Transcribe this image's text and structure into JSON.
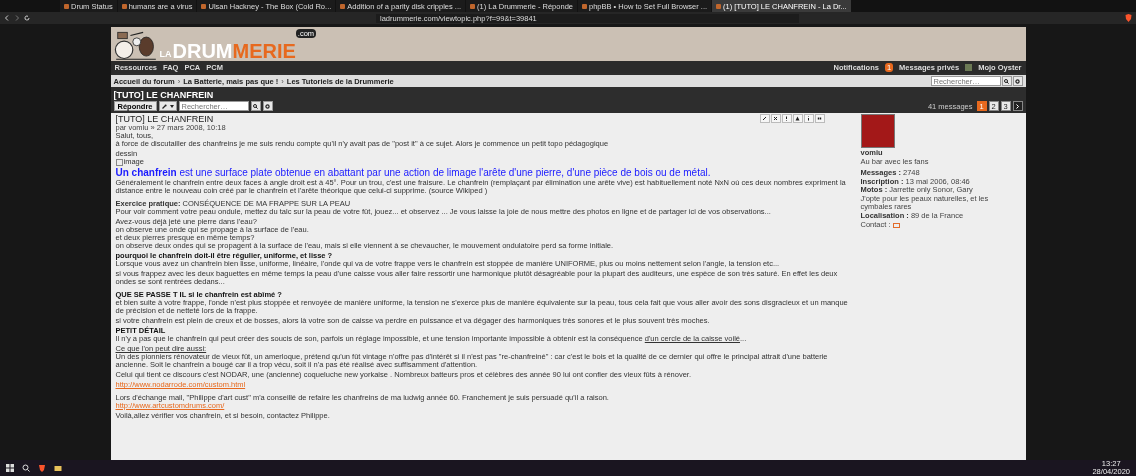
{
  "browser": {
    "tabs": [
      {
        "label": "Drum Status",
        "selected": false
      },
      {
        "label": "humans are a virus",
        "selected": false
      },
      {
        "label": "Ulsan Hackney - The Box (Cold Ro...",
        "selected": false
      },
      {
        "label": "Addition of a parity disk cripples ...",
        "selected": false
      },
      {
        "label": "(1) La Drummerie - Réponde",
        "selected": false
      },
      {
        "label": "phpBB • How to Set Full Browser ...",
        "selected": false
      },
      {
        "label": "(1) [TUTO] LE CHANFREIN - La Dr...",
        "selected": true
      }
    ],
    "address": "ladrummerie.com/viewtopic.php?f=99&t=39841"
  },
  "logo": {
    "la": "LA",
    "drum": "DRUM",
    "merie": "MERIE",
    "com": ".com"
  },
  "nav": {
    "left": [
      "Ressources",
      "FAQ",
      "PCA",
      "PCM"
    ],
    "notifications": "Notifications",
    "notif_count": "1",
    "messages": "Messages privés",
    "user": "Mojo Oyster"
  },
  "breadcrumbs": [
    "Accueil du forum",
    "La Batterie, mais pas que !",
    "Les Tutoriels de la Drummerie"
  ],
  "breadcrumb_separator": "›",
  "header_search": {
    "placeholder": "Rechercher…"
  },
  "topic_title": "[TUTO] LE CHANFREIN",
  "toolbar": {
    "reply": "Répondre",
    "search_placeholder": "Rechercher…",
    "count": "41 messages",
    "pages": [
      {
        "label": "1",
        "selected": true
      },
      {
        "label": "2",
        "selected": false
      },
      {
        "label": "3",
        "selected": false
      }
    ]
  },
  "post": {
    "title": "[TUTO] LE CHANFREIN",
    "meta": "par vomiu » 27 mars 2008, 10:18",
    "blocks": [
      {
        "kind": "p",
        "text": "Salut, tous,"
      },
      {
        "kind": "p",
        "text": "à force de discutailler des chanfreins je me suis rendu compte qu'il n'y avait pas de \"post it\" à ce sujet. Alors je commence un petit topo pédagogique"
      },
      {
        "kind": "gap"
      },
      {
        "kind": "p",
        "text": "dessin"
      },
      {
        "kind": "image",
        "text": "image"
      },
      {
        "kind": "big",
        "text": "**Un chanfrein** est une surface plate obtenue en abattant par une action de limage l'arête d'une pierre, d'une pièce de bois ou de métal."
      },
      {
        "kind": "p",
        "text": "Généralement le chanfrein entre deux faces à angle droit est à 45°. Pour un trou, c'est une fraisure. Le chanfrein (remplaçant par élimination une arête vive) est habituellement noté NxN où ces deux nombres expriment la distance entre le nouveau coin créé par le chanfrein et l'arête théorique que celui-ci supprime. (source Wikiped )"
      },
      {
        "kind": "gap"
      },
      {
        "kind": "gap"
      },
      {
        "kind": "p",
        "text": "**Exercice pratique:** CONSÉQUENCE DE MA FRAPPE SUR LA PEAU"
      },
      {
        "kind": "p",
        "text": "Pour voir comment votre peau ondule, mettez du talc sur la peau de votre fût, jouez... et observez ... Je vous laisse la joie de nous mettre des photos en ligne et de partager ici de vos observations..."
      },
      {
        "kind": "gap"
      },
      {
        "kind": "p",
        "text": "Avez-vous déjà jeté une pierre dans l'eau?"
      },
      {
        "kind": "p",
        "text": "on observe une onde qui se propage à la surface de l'eau."
      },
      {
        "kind": "p",
        "text": "et deux pierres presque en même temps?"
      },
      {
        "kind": "p",
        "text": "on observe deux ondes qui se propagent à la surface de l'eau, mais si elle viennent à se chevaucher, le mouvement ondulatoire perd sa forme initiale."
      },
      {
        "kind": "gap"
      },
      {
        "kind": "heading",
        "text": "pourquoi le chanfrein doit-il être régulier, uniforme, et lisse ?"
      },
      {
        "kind": "p",
        "text": "Lorsque vous avez un chanfrein bien lisse, uniforme, linéaire, l'onde qui va de votre frappe vers le chanfrein est stoppée de manière UNIFORME, plus ou moins nettement selon l'angle, la tension etc..."
      },
      {
        "kind": "gap"
      },
      {
        "kind": "p",
        "text": "si vous frappez avec les deux baguettes en même temps la peau d'une caisse vous aller faire ressortir une harmonique plutôt désagréable pour la plupart des auditeurs, une espèce de son très saturé. En effet les deux ondes se sont rentrées dedans..."
      },
      {
        "kind": "gap"
      },
      {
        "kind": "gap"
      },
      {
        "kind": "heading",
        "text": "QUE SE PASSE T IL si le chanfrein est abîmé ?"
      },
      {
        "kind": "p",
        "text": "et bien suite à votre frappe, l'onde n'est plus stoppée et renvoyée de manière uniforme, la tension ne s'exerce plus de manière équivalente sur la peau, tous cela fait que vous aller avoir des sons disgracieux et un manque de précision et de netteté lors de la frappe."
      },
      {
        "kind": "gap"
      },
      {
        "kind": "p",
        "text": "si votre chanfrein est plein de creux et de bosses, alors là votre son de caisse va perdre en puissance et va dégager des harmoniques très sonores et le plus souvent très moches."
      },
      {
        "kind": "gap"
      },
      {
        "kind": "heading",
        "text": "PETIT DÉTAIL"
      },
      {
        "kind": "p",
        "text": "Il n'y a pas que le chanfrein qui peut créer des soucis de son, parfois un réglage impossible, et une tension importante impossible à obtenir est la conséquence",
        "link": "d'un cercle de la caisse voilé",
        "after": "..."
      },
      {
        "kind": "gap"
      },
      {
        "kind": "underline",
        "text": "Ce que l'on peut dire aussi:"
      },
      {
        "kind": "p",
        "text": "Un des pionniers rénovateur de vieux fût, un amerloque, prétend qu'un fût vintage n'offre pas d'intérêt si il n'est pas \"re-chanfreiné\" : car c'est le bois et la qualité de ce dernier qui offre le principal attrait d'une batterie ancienne. Soit le chanfrein a bougé car il a trop vécu, soit il n'a pas été réalisé avec suffisamment d'attention."
      },
      {
        "kind": "gap"
      },
      {
        "kind": "p",
        "text": "Celui qui tient ce discours c'est NODAR, une (ancienne) coqueluche new yorkaise . Nombreux batteurs pros et célèbres des année 90 lui ont confier des vieux fûts à rénover."
      },
      {
        "kind": "gap"
      },
      {
        "kind": "url",
        "text": "http://www.nodarrode.com/custom.html"
      },
      {
        "kind": "gap"
      },
      {
        "kind": "gap"
      },
      {
        "kind": "p",
        "text": "Lors d'échange mail, \"Philippe d'art cust\" m'a conseillé de refaire les chanfreins de ma ludwig année 60. Franchement je suis persuadé qu'il a raison."
      },
      {
        "kind": "url",
        "text": "http://www.artcustomdrums.com/"
      },
      {
        "kind": "gap"
      },
      {
        "kind": "p",
        "text": "Voilà,allez vérifier vos chanfrein, et si besoin, contactez Philippe."
      }
    ]
  },
  "profile": {
    "username": "vomiu",
    "rank": "Au bar avec les fans",
    "fields": [
      {
        "label": "Messages :",
        "value": "2748"
      },
      {
        "label": "Inscription :",
        "value": "13 mai 2006, 08:46"
      },
      {
        "label": "Motos :",
        "value": "Jarrette only Sonor, Gary"
      },
      {
        "value": "J'opte pour les peaux naturelles, et les cymbales rares"
      },
      {
        "label": "Localisation :",
        "value": "89 de la France"
      }
    ],
    "contact": "Contact :"
  },
  "taskbar": {
    "time": "13:27",
    "date": "28/04/2020"
  }
}
